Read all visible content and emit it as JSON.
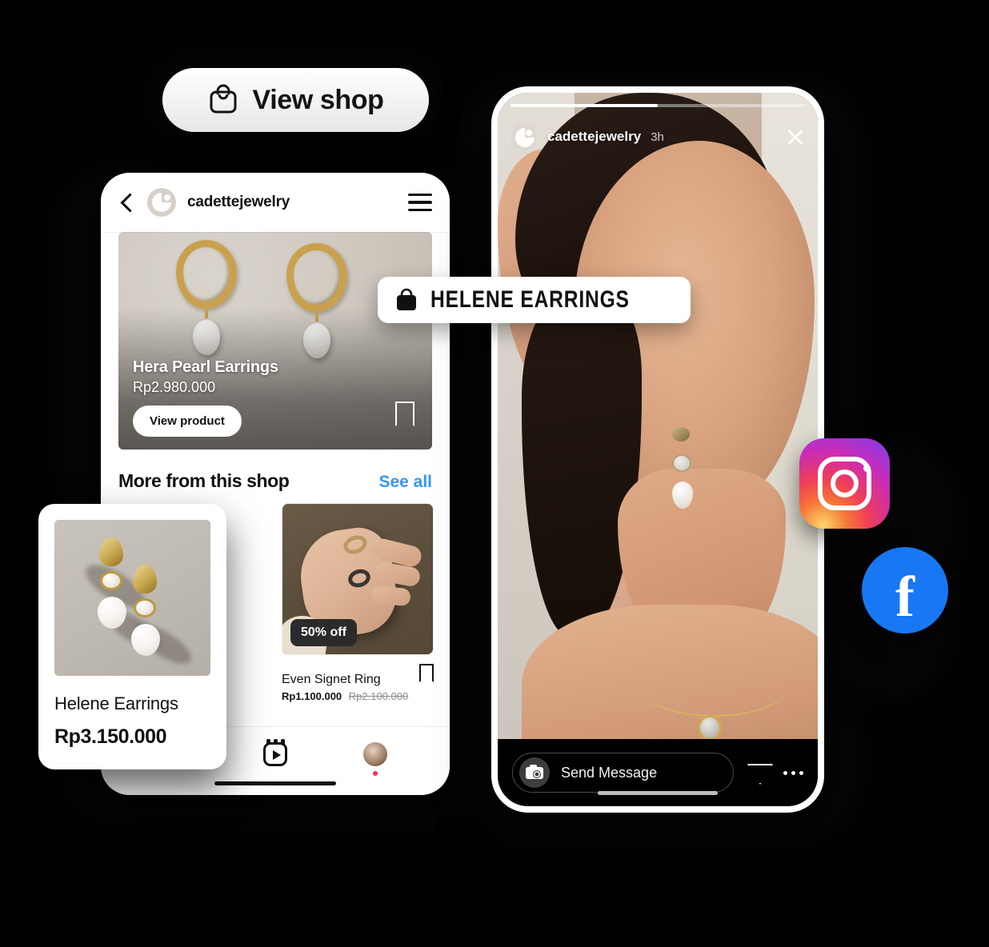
{
  "view_shop": {
    "label": "View shop",
    "icon": "shopping-bag-icon"
  },
  "shop_phone": {
    "header": {
      "back_icon": "back-chevron-icon",
      "account_name": "cadettejewelry",
      "menu_icon": "hamburger-menu-icon",
      "avatar": "account-avatar"
    },
    "featured_product": {
      "title": "Hera Pearl Earrings",
      "price": "Rp2.980.000",
      "cta": "View product",
      "bookmark_icon": "bookmark-icon"
    },
    "section": {
      "title": "More from this shop",
      "see_all": "See all"
    },
    "products": [
      {
        "name": "Even Signet Ring",
        "price": "Rp1.100.000",
        "price_original": "Rp2.100.000",
        "badge": "50% off",
        "bookmark_icon": "bookmark-icon"
      }
    ],
    "tabbar": [
      {
        "name": "create-tab",
        "icon": "plus-square-icon"
      },
      {
        "name": "reels-tab",
        "icon": "reels-icon"
      },
      {
        "name": "profile-tab",
        "icon": "profile-avatar-icon"
      }
    ]
  },
  "helene_card": {
    "name": "Helene Earrings",
    "price": "Rp3.150.000",
    "image": "helene-earrings-photo"
  },
  "product_tag": {
    "label": "HELENE EARRINGS",
    "icon": "shopping-bag-icon"
  },
  "story_phone": {
    "progress_percent": 50,
    "header": {
      "account_name": "cadettejewelry",
      "time": "3h",
      "close_icon": "close-icon",
      "avatar": "account-avatar"
    },
    "footer": {
      "message_placeholder": "Send Message",
      "camera_icon": "camera-icon",
      "share_icon": "paper-plane-icon",
      "more_icon": "more-options-icon"
    }
  },
  "social_badges": [
    {
      "name": "instagram-badge",
      "label": "Instagram"
    },
    {
      "name": "facebook-badge",
      "label": "f"
    }
  ],
  "colors": {
    "background": "#000000",
    "accent_blue": "#3897f0",
    "facebook_blue": "#1877f2",
    "badge_dark": "#2b2b2b"
  }
}
